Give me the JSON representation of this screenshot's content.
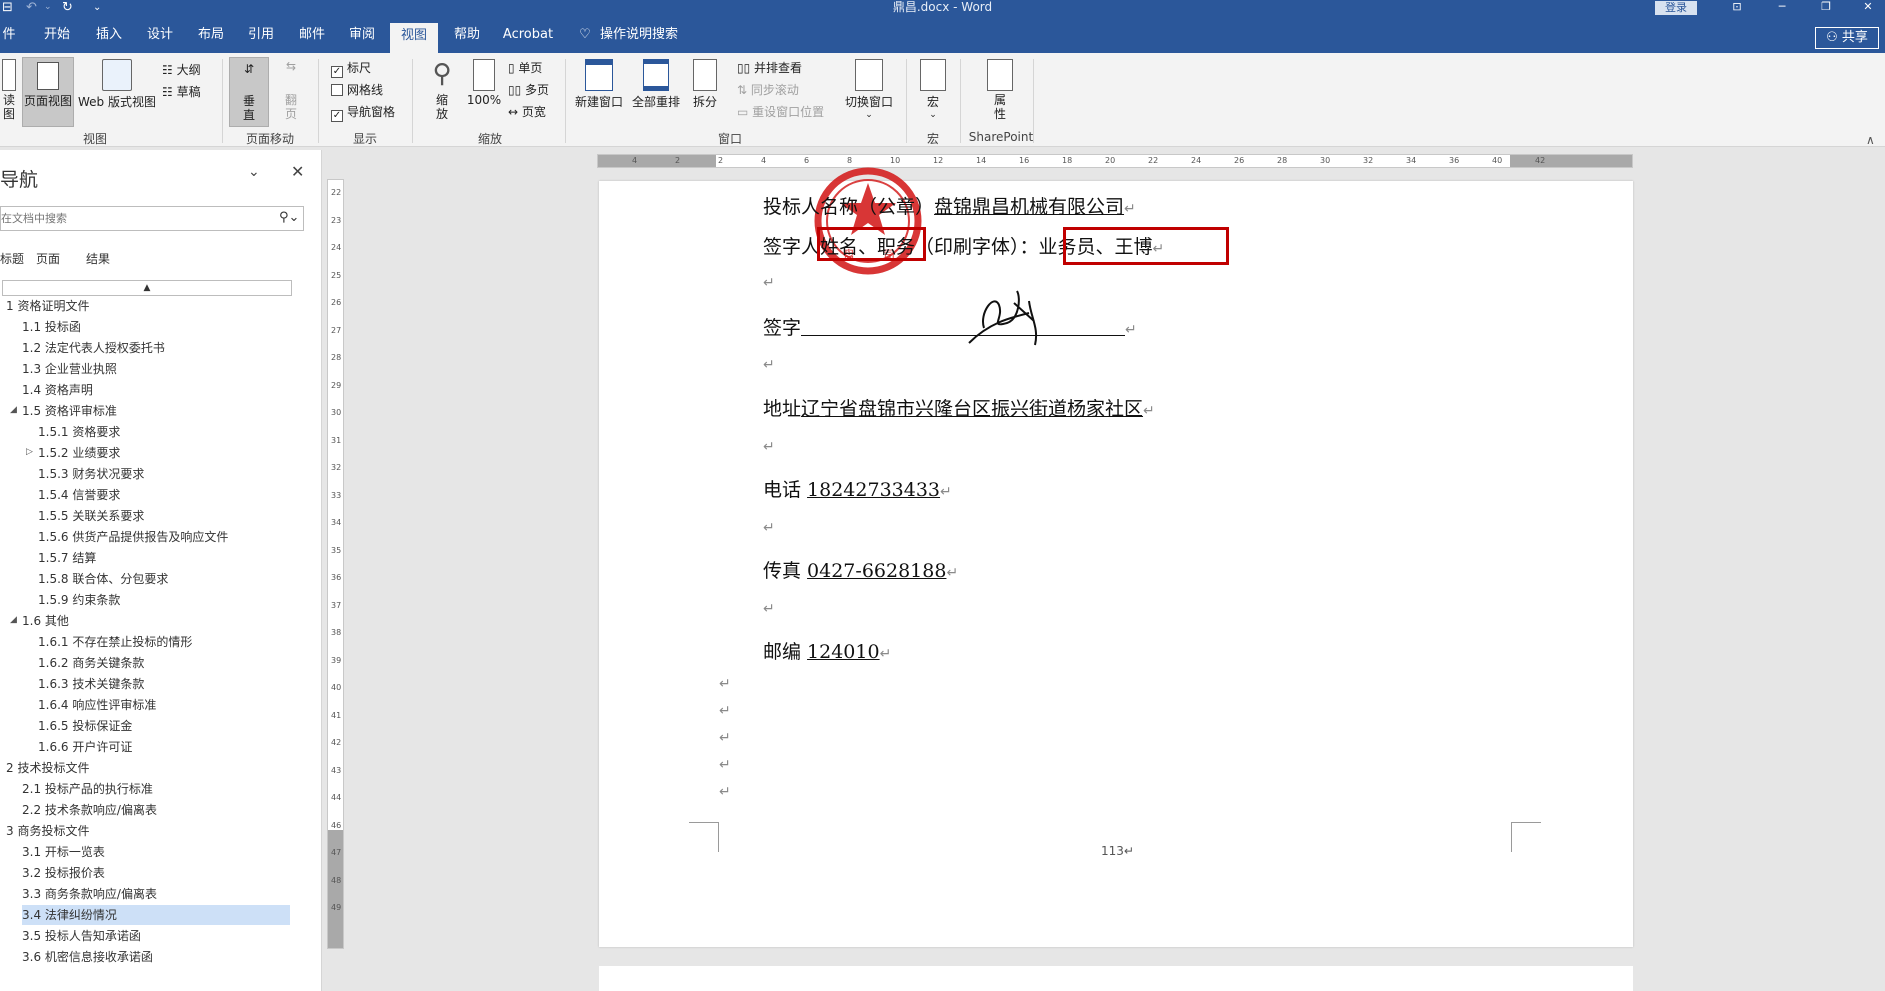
{
  "window": {
    "title": "鼎昌.docx  -  Word",
    "login": "登录",
    "share": "共享"
  },
  "tabs": [
    "件",
    "开始",
    "插入",
    "设计",
    "布局",
    "引用",
    "邮件",
    "审阅",
    "视图",
    "帮助",
    "Acrobat",
    "操作说明搜索"
  ],
  "active_tab": "视图",
  "ribbon": {
    "views": {
      "read": "读\n图",
      "print_layout": "页面视图",
      "web_layout": "Web 版式视图",
      "outline": "大纲",
      "draft": "草稿",
      "group": "视图"
    },
    "page_move": {
      "vertical": "垂\n直",
      "side": "翻\n页",
      "group": "页面移动"
    },
    "show": {
      "ruler": "标尺",
      "gridlines": "网格线",
      "nav_pane": "导航窗格",
      "group": "显示",
      "ruler_checked": true,
      "gridlines_checked": false,
      "nav_checked": true
    },
    "zoom": {
      "zoom": "缩\n放",
      "percent": "100%",
      "one_page": "单页",
      "multi_page": "多页",
      "page_width": "页宽",
      "group": "缩放"
    },
    "window": {
      "new_window": "新建窗口",
      "arrange_all": "全部重排",
      "split": "拆分",
      "side_by_side": "并排查看",
      "sync_scroll": "同步滚动",
      "reset_pos": "重设窗口位置",
      "switch": "切换窗口",
      "group": "窗口"
    },
    "macros": {
      "label": "宏",
      "group": "宏"
    },
    "sharepoint": {
      "label": "属\n性",
      "group": "SharePoint"
    }
  },
  "nav": {
    "title": "导航",
    "search_placeholder": "在文档中搜索",
    "tabs": [
      "标题",
      "页面",
      "结果"
    ],
    "items": [
      {
        "text": "1 资格证明文件",
        "level": 0
      },
      {
        "text": "1.1 投标函",
        "level": 1
      },
      {
        "text": "1.2 法定代表人授权委托书",
        "level": 1
      },
      {
        "text": "1.3 企业营业执照",
        "level": 1
      },
      {
        "text": "1.4 资格声明",
        "level": 1
      },
      {
        "text": "1.5 资格评审标准",
        "level": 1,
        "tri": "◢"
      },
      {
        "text": "1.5.1 资格要求",
        "level": 2
      },
      {
        "text": "1.5.2 业绩要求",
        "level": 2,
        "tri": "▷"
      },
      {
        "text": "1.5.3 财务状况要求",
        "level": 2
      },
      {
        "text": "1.5.4 信誉要求",
        "level": 2
      },
      {
        "text": "1.5.5 关联关系要求",
        "level": 2
      },
      {
        "text": "1.5.6 供货产品提供报告及响应文件",
        "level": 2
      },
      {
        "text": "1.5.7 结算",
        "level": 2
      },
      {
        "text": "1.5.8 联合体、分包要求",
        "level": 2
      },
      {
        "text": "1.5.9 约束条款",
        "level": 2
      },
      {
        "text": "1.6 其他",
        "level": 1,
        "tri": "◢"
      },
      {
        "text": "1.6.1 不存在禁止投标的情形",
        "level": 2
      },
      {
        "text": "1.6.2 商务关键条款",
        "level": 2
      },
      {
        "text": "1.6.3 技术关键条款",
        "level": 2
      },
      {
        "text": "1.6.4 响应性评审标准",
        "level": 2
      },
      {
        "text": "1.6.5 投标保证金",
        "level": 2
      },
      {
        "text": "1.6.6 开户许可证",
        "level": 2
      },
      {
        "text": "2 技术投标文件",
        "level": 0
      },
      {
        "text": "2.1 投标产品的执行标准",
        "level": 1
      },
      {
        "text": "2.2 技术条款响应/偏离表",
        "level": 1
      },
      {
        "text": "3 商务投标文件",
        "level": 0
      },
      {
        "text": "3.1 开标一览表",
        "level": 1
      },
      {
        "text": "3.2 投标报价表",
        "level": 1
      },
      {
        "text": "3.3 商务条款响应/偏离表",
        "level": 1
      },
      {
        "text": "3.4 法律纠纷情况",
        "level": 1,
        "selected": true
      },
      {
        "text": "3.5 投标人告知承诺函",
        "level": 1
      },
      {
        "text": "3.6 机密信息接收承诺函",
        "level": 1
      }
    ]
  },
  "ruler": {
    "h_ticks": [
      "4",
      "2",
      "2",
      "4",
      "6",
      "8",
      "10",
      "12",
      "14",
      "16",
      "18",
      "20",
      "22",
      "24",
      "26",
      "28",
      "30",
      "32",
      "34",
      "36",
      "40",
      "42"
    ],
    "v_ticks": [
      "22",
      "23",
      "24",
      "25",
      "26",
      "27",
      "28",
      "29",
      "30",
      "31",
      "32",
      "33",
      "34",
      "35",
      "36",
      "37",
      "38",
      "39",
      "40",
      "41",
      "42",
      "43",
      "44",
      "46",
      "47",
      "48",
      "49"
    ]
  },
  "doc": {
    "bidder_label": "投标人名称（公章）",
    "bidder_value": "盘锦鼎昌机械有限公司",
    "sign_label": "签字人姓名、职务（印刷字体）：",
    "sign_value": "业务员、王博",
    "signature_label": "签字",
    "address_label": "地址",
    "address_value": "辽宁省盘锦市兴隆台区振兴街道杨家社区",
    "phone_label": "电话 ",
    "phone_value": "18242733433",
    "fax_label": "传真 ",
    "fax_value": "0427-6628188",
    "post_label": "邮编 ",
    "post_value": "124010",
    "page_number": "113",
    "para_mark": "↵",
    "stamp_color": "#d42020",
    "highlight_color": "#c00000"
  }
}
